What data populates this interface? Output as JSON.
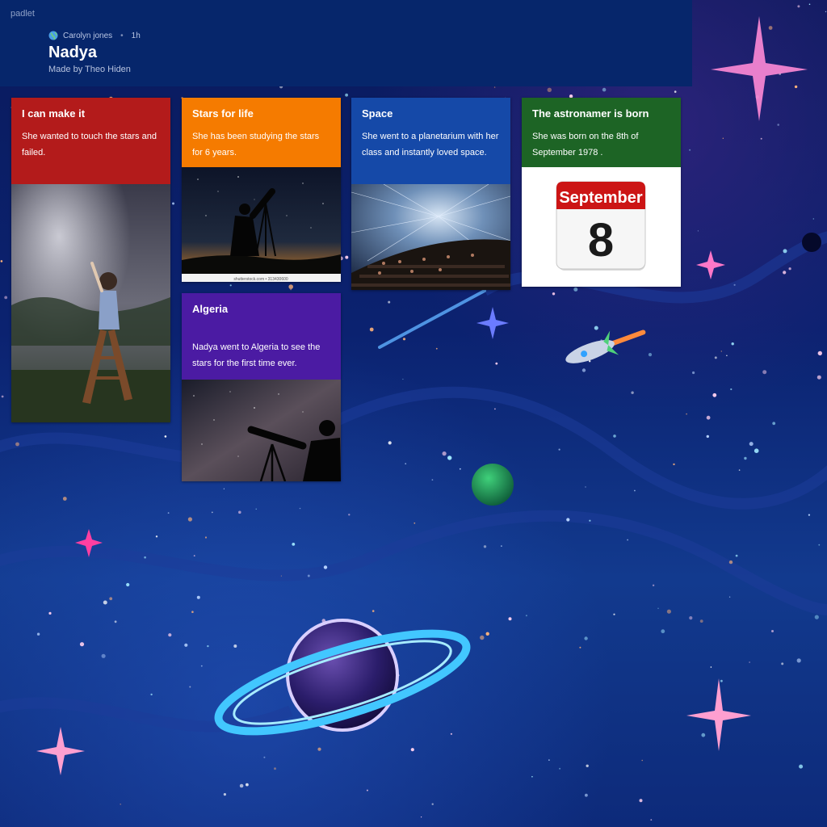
{
  "header": {
    "brand": "padlet",
    "author": "Carolyn jones",
    "time": "1h",
    "title": "Nadya",
    "subtitle": "Made by Theo Hiden"
  },
  "posts": [
    {
      "title": "I can make it",
      "body": "She wanted to touch the stars and failed."
    },
    {
      "title": "Stars for life",
      "body": "She has been studying the stars for 6 years.",
      "image_caption": "shutterstock.com • 313430600"
    },
    {
      "title": "Space",
      "body": "She went to a planetarium with her class and instantly loved space."
    },
    {
      "title": "The astronamer is born",
      "body": "She was born on the 8th of September 1978 .",
      "calendar_month": "September",
      "calendar_day": "8"
    },
    {
      "title": "Algeria",
      "body": "Nadya went to Algeria to see the stars for the first time ever."
    }
  ],
  "colors": {
    "red": "#b31b1b",
    "orange": "#f57b00",
    "blue": "#1549a8",
    "green": "#1d6425",
    "purple": "#4b1ba3",
    "header": "#06266b"
  },
  "icons": {
    "author_avatar": "globe-icon"
  }
}
